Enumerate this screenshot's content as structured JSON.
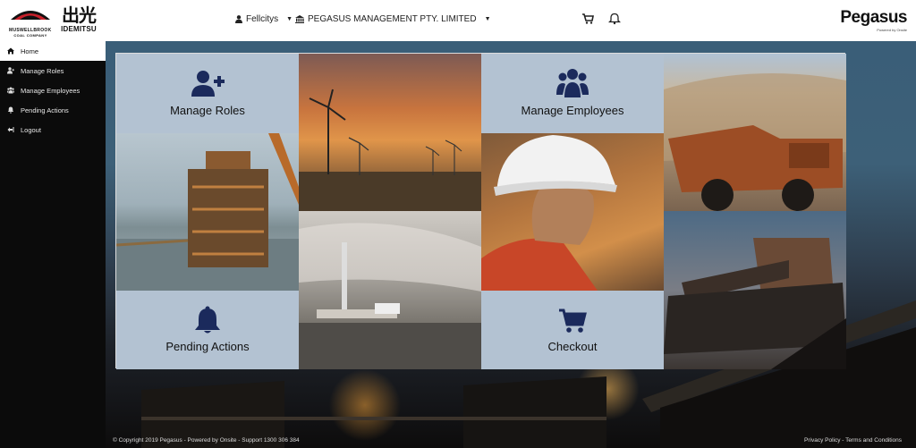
{
  "header": {
    "logo_left": {
      "line1": "MUSWELLBROOK",
      "line2": "COAL COMPANY"
    },
    "logo_idemitsu": {
      "kanji": "出光",
      "brand": "IDEMITSU"
    },
    "user": {
      "icon": "user-icon",
      "label": "Fellcitys"
    },
    "organisation": {
      "icon": "building-icon",
      "label": "PEGASUS MANAGEMENT PTY. LIMITED"
    },
    "cart_icon": "cart-icon",
    "bell_icon": "bell-icon",
    "brand": {
      "name": "Pegasus",
      "powered_by": "Powered by Onsite"
    }
  },
  "sidebar": {
    "items": [
      {
        "label": "Home",
        "icon": "home-icon",
        "active": true
      },
      {
        "label": "Manage Roles",
        "icon": "user-plus-icon",
        "active": false
      },
      {
        "label": "Manage Employees",
        "icon": "users-icon",
        "active": false
      },
      {
        "label": "Pending Actions",
        "icon": "bell-icon",
        "active": false
      },
      {
        "label": "Logout",
        "icon": "logout-icon",
        "active": false
      }
    ]
  },
  "tiles": {
    "manage_roles": {
      "label": "Manage Roles",
      "icon": "user-plus-icon"
    },
    "manage_employees": {
      "label": "Manage Employees",
      "icon": "users-icon"
    },
    "pending_actions": {
      "label": "Pending Actions",
      "icon": "bell-icon"
    },
    "checkout": {
      "label": "Checkout",
      "icon": "cart-icon"
    }
  },
  "footer": {
    "copyright": "© Copyright 2019 Pegasus - Powered by Onsite - Support 1300 306 384",
    "links": "Privacy Policy - Terms and Conditions"
  },
  "colors": {
    "tile_bg": "#b3c2d2",
    "icon_navy": "#1b2a5c",
    "sidebar_bg": "#0b0b0b"
  }
}
